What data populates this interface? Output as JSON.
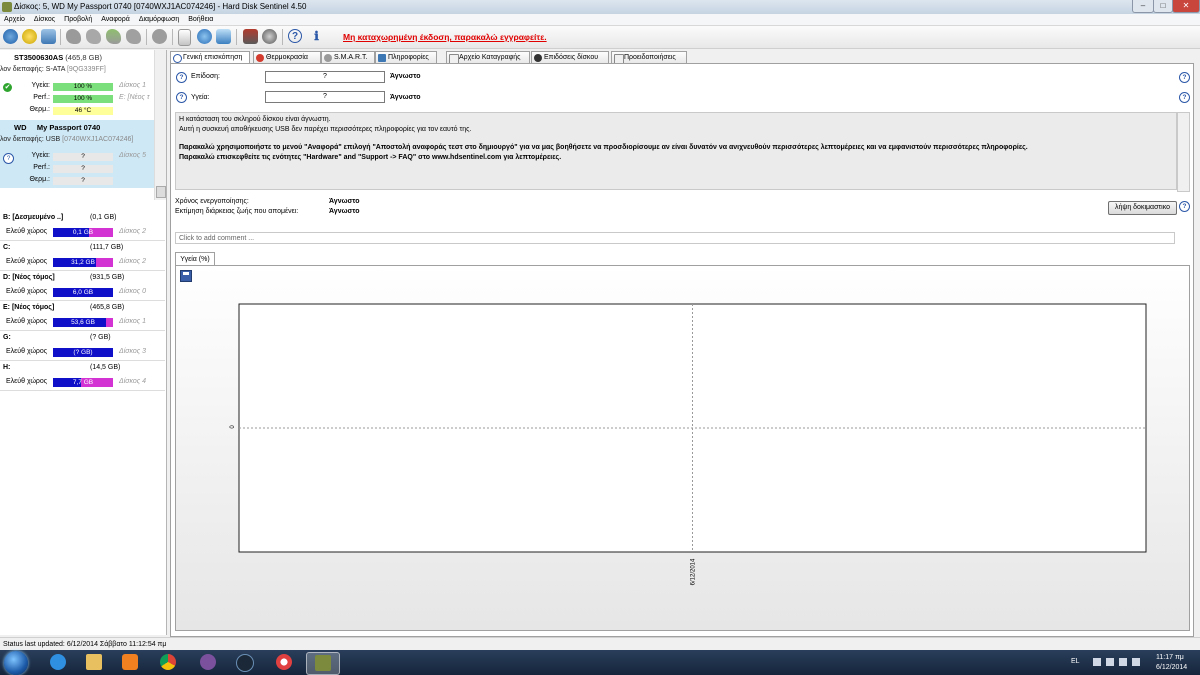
{
  "window": {
    "title": "Δίσκος: 5, WD      My Passport 0740 [0740WXJ1AC074246]  -  Hard Disk Sentinel 4.50",
    "minimize": "–",
    "maximize": "□",
    "close": "✕"
  },
  "menu": [
    "Αρχείο",
    "Δίσκος",
    "Προβολή",
    "Αναφορά",
    "Διαμόρφωση",
    "Βοήθεια"
  ],
  "toolbar": {
    "notice": "Μη καταχωρημένη έκδοση, παρακαλώ εγγραφείτε.",
    "icons": [
      "refresh-icon",
      "warning-icon",
      "mail-icon",
      "tool1-icon",
      "tool2-icon",
      "tool3-icon",
      "tool4-icon",
      "tool5-icon",
      "report-icon",
      "refresh2-icon",
      "monitor-icon",
      "settings-icon",
      "disk-icon",
      "help-icon",
      "info-icon"
    ]
  },
  "left": {
    "disk1": {
      "name": "ST3500630AS",
      "size": "(465,8 GB)",
      "iface_label": "λον διεπαφής:",
      "iface": "S-ATA",
      "serial": "[9QG339FF]",
      "health_label": "Υγεία:",
      "health": "100 %",
      "perf_label": "Perf.:",
      "perf": "100 %",
      "temp_label": "Θερμ.:",
      "temp": "46 °C",
      "side1": "Δίσκος 1",
      "side2": "E: [Νέος τ"
    },
    "disk2": {
      "name_a": "WD",
      "name_b": "My Passport 0740",
      "iface_label": "λον διεπαφής:",
      "iface": "USB",
      "serial": "[0740WXJ1AC074246]",
      "health_label": "Υγεία:",
      "health": "?",
      "perf_label": "Perf.:",
      "perf": "?",
      "temp_label": "Θερμ.:",
      "temp": "?",
      "side1": "Δίσκος 5"
    },
    "volumes": [
      {
        "name": "B: [Δεσμευμένο ..]",
        "size": "(0,1 GB)",
        "free_label": "Ελεύθ χώρος",
        "free": "0,1 GB",
        "disk": "Δίσκος 2",
        "fill": 0.6
      },
      {
        "name": "C:",
        "size": "(111,7 GB)",
        "free_label": "Ελεύθ χώρος",
        "free": "31,2 GB",
        "disk": "Δίσκος 2",
        "fill": 0.72
      },
      {
        "name": "D: [Νέος τόμος]",
        "size": "(931,5 GB)",
        "free_label": "Ελεύθ χώρος",
        "free": "6,0 GB",
        "disk": "Δίσκος 0",
        "fill": 1.0
      },
      {
        "name": "E: [Νέος τόμος]",
        "size": "(465,8 GB)",
        "free_label": "Ελεύθ χώρος",
        "free": "53,6 GB",
        "disk": "Δίσκος 1",
        "fill": 0.88
      },
      {
        "name": "G:",
        "size": "(? GB)",
        "free_label": "Ελεύθ χώρος",
        "free": "(? GB)",
        "disk": "Δίσκος 3",
        "fill": 1.0
      },
      {
        "name": "H:",
        "size": "(14,5 GB)",
        "free_label": "Ελεύθ χώρος",
        "free": "7,7 GB",
        "disk": "Δίσκος 4",
        "fill": 0.47
      }
    ]
  },
  "tabs": [
    "Γενική επισκόπηση",
    "Θερμοκρασία",
    "S.M.A.R.T.",
    "Πληροφορίες",
    "Αρχείο Καταγραφής",
    "Επιδόσεις δίσκου",
    "Προειδοποιήσεις"
  ],
  "overview": {
    "perf_label": "Επίδοση:",
    "perf_box": "?",
    "perf_val": "Άγνωστο",
    "health_label": "Υγεία:",
    "health_box": "?",
    "health_val": "Άγνωστο",
    "msg1": "Η κατάσταση του σκληρού δίσκου είναι άγνωστη.",
    "msg2": "Αυτή η συσκευή αποθήκευσης USB δεν παρέχει περισσότερες πληροφορίες για τον εαυτό της.",
    "msg3": "Παρακαλώ χρησιμοποιήστε το μενού \"Αναφορά\" επιλογή \"Αποστολή αναφοράς τεστ στο δημιουργό\" για να μας βοηθήσετε να προσδιορίσουμε αν είναι δυνατόν να ανιχνευθούν περισσότερες λεπτομέρειες και να εμφανιστούν περισσότερες πληροφορίες.",
    "msg4": "Παρακαλώ επισκεφθείτε τις ενότητες \"Hardware\" and \"Support -> FAQ\" στο www.hdsentinel.com για λεπτομέρειες.",
    "power_label": "Χρόνος ενεργοποίησης:",
    "power_val": "Άγνωστο",
    "life_label": "Εκτίμηση διάρκειας ζωής που απομένει:",
    "life_val": "Άγνωστο",
    "test_button": "λήψη δοκιμαστικο",
    "comment_placeholder": "Click to add comment ...",
    "chart_tab": "Υγεία (%)"
  },
  "chart_data": {
    "type": "line",
    "x": [
      "6/12/2014"
    ],
    "y_ticks": [
      "0"
    ],
    "series": [
      {
        "values": [
          null
        ]
      }
    ],
    "grid": true
  },
  "status": "Status last updated: 6/12/2014 Σάββατο 11:12:54 πμ",
  "tray": {
    "lang": "EL",
    "time": "11:17 πμ",
    "date": "6/12/2014"
  }
}
